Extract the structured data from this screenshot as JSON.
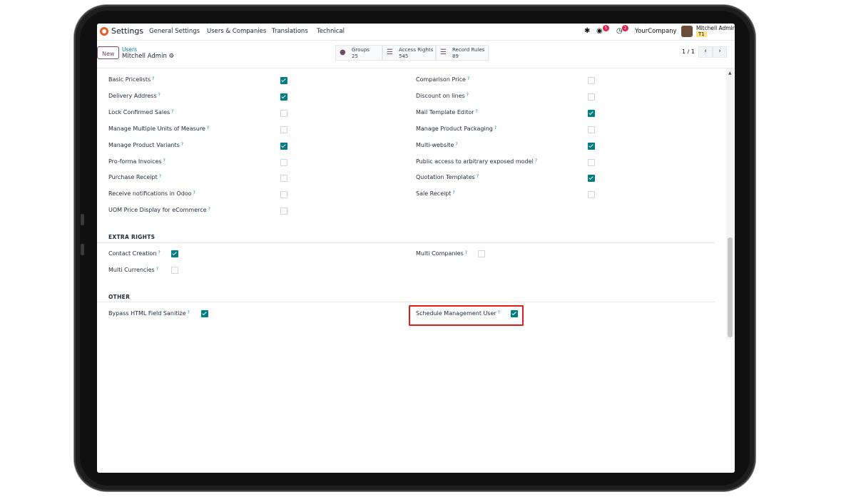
{
  "navbar": {
    "app_name": "Settings",
    "menus": [
      "General Settings",
      "Users & Companies",
      "Translations",
      "Technical"
    ],
    "chat_badge": "5",
    "activity_badge": "2",
    "company": "YourCompany",
    "user_name": "Mitchell Admin",
    "user_company": "T1"
  },
  "control": {
    "new_label": "New",
    "breadcrumb_parent": "Users",
    "record_title": "Mitchell Admin",
    "smart_buttons": [
      {
        "label": "Groups",
        "count": "25"
      },
      {
        "label": "Access Rights",
        "count": "545"
      },
      {
        "label": "Record Rules",
        "count": "89"
      }
    ],
    "pager": "1 / 1"
  },
  "left_rights": [
    {
      "label": "Basic Pricelists",
      "checked": true
    },
    {
      "label": "Delivery Address",
      "checked": true
    },
    {
      "label": "Lock Confirmed Sales",
      "checked": false
    },
    {
      "label": "Manage Multiple Units of Measure",
      "checked": false
    },
    {
      "label": "Manage Product Variants",
      "checked": true
    },
    {
      "label": "Pro-forma Invoices",
      "checked": false
    },
    {
      "label": "Purchase Receipt",
      "checked": false
    },
    {
      "label": "Receive notifications in Odoo",
      "checked": false
    },
    {
      "label": "UOM Price Display for eCommerce",
      "checked": false
    }
  ],
  "right_rights": [
    {
      "label": "Comparison Price",
      "checked": false
    },
    {
      "label": "Discount on lines",
      "checked": false
    },
    {
      "label": "Mail Template Editor",
      "checked": true
    },
    {
      "label": "Manage Product Packaging",
      "checked": false
    },
    {
      "label": "Multi-website",
      "checked": true
    },
    {
      "label": "Public access to arbitrary exposed model",
      "checked": false
    },
    {
      "label": "Quotation Templates",
      "checked": true
    },
    {
      "label": "Sale Receipt",
      "checked": false
    }
  ],
  "extra_rights": {
    "title": "EXTRA RIGHTS",
    "contact_creation": {
      "label": "Contact Creation",
      "checked": true
    },
    "multi_companies": {
      "label": "Multi Companies",
      "checked": false
    },
    "multi_currencies": {
      "label": "Multi Currencies",
      "checked": false
    }
  },
  "other": {
    "title": "OTHER",
    "bypass_html": {
      "label": "Bypass HTML Field Sanitize",
      "checked": true
    },
    "schedule_mgmt": {
      "label": "Schedule Management User",
      "checked": true
    }
  },
  "help_mark": "?",
  "colors": {
    "accent": "#017e84",
    "brand": "#714b67",
    "highlight": "#e11d1d"
  }
}
